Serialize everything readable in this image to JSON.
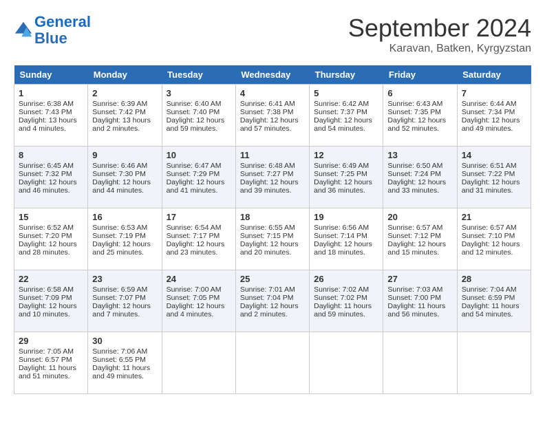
{
  "header": {
    "logo_line1": "General",
    "logo_line2": "Blue",
    "month": "September 2024",
    "location": "Karavan, Batken, Kyrgyzstan"
  },
  "days_of_week": [
    "Sunday",
    "Monday",
    "Tuesday",
    "Wednesday",
    "Thursday",
    "Friday",
    "Saturday"
  ],
  "weeks": [
    [
      {
        "day": 1,
        "sunrise": "6:38 AM",
        "sunset": "7:43 PM",
        "daylight": "13 hours and 4 minutes."
      },
      {
        "day": 2,
        "sunrise": "6:39 AM",
        "sunset": "7:42 PM",
        "daylight": "13 hours and 2 minutes."
      },
      {
        "day": 3,
        "sunrise": "6:40 AM",
        "sunset": "7:40 PM",
        "daylight": "12 hours and 59 minutes."
      },
      {
        "day": 4,
        "sunrise": "6:41 AM",
        "sunset": "7:38 PM",
        "daylight": "12 hours and 57 minutes."
      },
      {
        "day": 5,
        "sunrise": "6:42 AM",
        "sunset": "7:37 PM",
        "daylight": "12 hours and 54 minutes."
      },
      {
        "day": 6,
        "sunrise": "6:43 AM",
        "sunset": "7:35 PM",
        "daylight": "12 hours and 52 minutes."
      },
      {
        "day": 7,
        "sunrise": "6:44 AM",
        "sunset": "7:34 PM",
        "daylight": "12 hours and 49 minutes."
      }
    ],
    [
      {
        "day": 8,
        "sunrise": "6:45 AM",
        "sunset": "7:32 PM",
        "daylight": "12 hours and 46 minutes."
      },
      {
        "day": 9,
        "sunrise": "6:46 AM",
        "sunset": "7:30 PM",
        "daylight": "12 hours and 44 minutes."
      },
      {
        "day": 10,
        "sunrise": "6:47 AM",
        "sunset": "7:29 PM",
        "daylight": "12 hours and 41 minutes."
      },
      {
        "day": 11,
        "sunrise": "6:48 AM",
        "sunset": "7:27 PM",
        "daylight": "12 hours and 39 minutes."
      },
      {
        "day": 12,
        "sunrise": "6:49 AM",
        "sunset": "7:25 PM",
        "daylight": "12 hours and 36 minutes."
      },
      {
        "day": 13,
        "sunrise": "6:50 AM",
        "sunset": "7:24 PM",
        "daylight": "12 hours and 33 minutes."
      },
      {
        "day": 14,
        "sunrise": "6:51 AM",
        "sunset": "7:22 PM",
        "daylight": "12 hours and 31 minutes."
      }
    ],
    [
      {
        "day": 15,
        "sunrise": "6:52 AM",
        "sunset": "7:20 PM",
        "daylight": "12 hours and 28 minutes."
      },
      {
        "day": 16,
        "sunrise": "6:53 AM",
        "sunset": "7:19 PM",
        "daylight": "12 hours and 25 minutes."
      },
      {
        "day": 17,
        "sunrise": "6:54 AM",
        "sunset": "7:17 PM",
        "daylight": "12 hours and 23 minutes."
      },
      {
        "day": 18,
        "sunrise": "6:55 AM",
        "sunset": "7:15 PM",
        "daylight": "12 hours and 20 minutes."
      },
      {
        "day": 19,
        "sunrise": "6:56 AM",
        "sunset": "7:14 PM",
        "daylight": "12 hours and 18 minutes."
      },
      {
        "day": 20,
        "sunrise": "6:57 AM",
        "sunset": "7:12 PM",
        "daylight": "12 hours and 15 minutes."
      },
      {
        "day": 21,
        "sunrise": "6:57 AM",
        "sunset": "7:10 PM",
        "daylight": "12 hours and 12 minutes."
      }
    ],
    [
      {
        "day": 22,
        "sunrise": "6:58 AM",
        "sunset": "7:09 PM",
        "daylight": "12 hours and 10 minutes."
      },
      {
        "day": 23,
        "sunrise": "6:59 AM",
        "sunset": "7:07 PM",
        "daylight": "12 hours and 7 minutes."
      },
      {
        "day": 24,
        "sunrise": "7:00 AM",
        "sunset": "7:05 PM",
        "daylight": "12 hours and 4 minutes."
      },
      {
        "day": 25,
        "sunrise": "7:01 AM",
        "sunset": "7:04 PM",
        "daylight": "12 hours and 2 minutes."
      },
      {
        "day": 26,
        "sunrise": "7:02 AM",
        "sunset": "7:02 PM",
        "daylight": "11 hours and 59 minutes."
      },
      {
        "day": 27,
        "sunrise": "7:03 AM",
        "sunset": "7:00 PM",
        "daylight": "11 hours and 56 minutes."
      },
      {
        "day": 28,
        "sunrise": "7:04 AM",
        "sunset": "6:59 PM",
        "daylight": "11 hours and 54 minutes."
      }
    ],
    [
      {
        "day": 29,
        "sunrise": "7:05 AM",
        "sunset": "6:57 PM",
        "daylight": "11 hours and 51 minutes."
      },
      {
        "day": 30,
        "sunrise": "7:06 AM",
        "sunset": "6:55 PM",
        "daylight": "11 hours and 49 minutes."
      },
      null,
      null,
      null,
      null,
      null
    ]
  ]
}
